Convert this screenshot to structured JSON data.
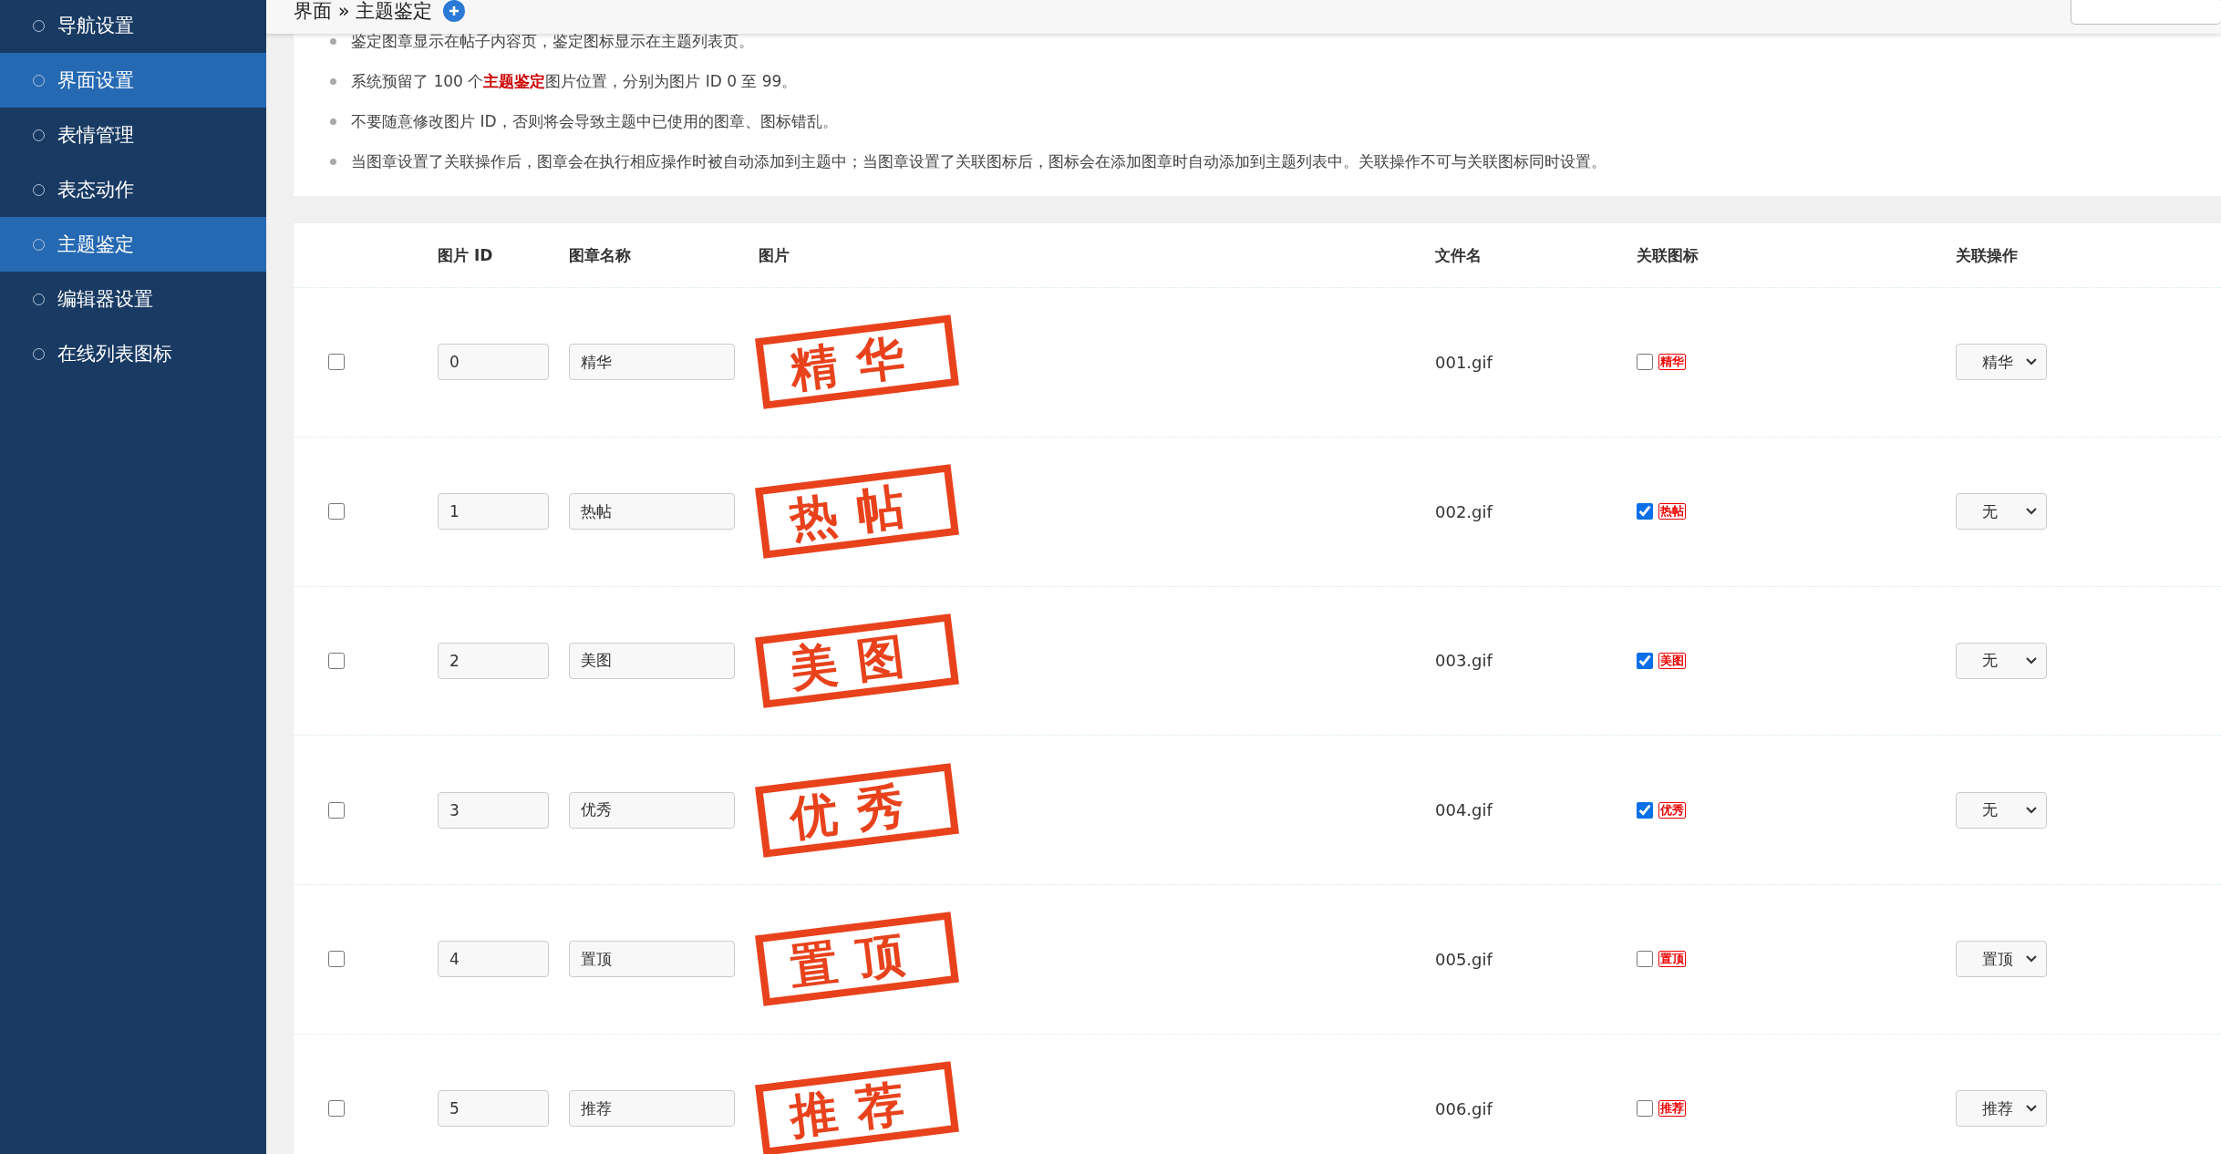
{
  "sidebar": {
    "items": [
      {
        "label": "导航设置",
        "selected": false
      },
      {
        "label": "界面设置",
        "selected": true
      },
      {
        "label": "表情管理",
        "selected": false
      },
      {
        "label": "表态动作",
        "selected": false
      },
      {
        "label": "主题鉴定",
        "selected": true
      },
      {
        "label": "编辑器设置",
        "selected": false
      },
      {
        "label": "在线列表图标",
        "selected": false
      }
    ]
  },
  "header": {
    "breadcrumb": "界面 » 主题鉴定"
  },
  "notes": [
    "鉴定图章显示在帖子内容页，鉴定图标显示在主题列表页。",
    "系统预留了 100 个**主题鉴定**图片位置，分别为图片 ID 0 至 99。",
    "不要随意修改图片 ID，否则将会导致主题中已使用的图章、图标错乱。",
    "当图章设置了关联操作后，图章会在执行相应操作时被自动添加到主题中；当图章设置了关联图标后，图标会在添加图章时自动添加到主题列表中。关联操作不可与关联图标同时设置。"
  ],
  "table": {
    "columns": [
      "图片 ID",
      "图章名称",
      "图片",
      "文件名",
      "关联图标",
      "关联操作"
    ],
    "rows": [
      {
        "selected": false,
        "id": "0",
        "name": "精华",
        "stamp": "精华",
        "file": "001.gif",
        "icon_checked": false,
        "icon_label": "精华",
        "action": "精华"
      },
      {
        "selected": false,
        "id": "1",
        "name": "热帖",
        "stamp": "热帖",
        "file": "002.gif",
        "icon_checked": true,
        "icon_label": "热帖",
        "action": "无"
      },
      {
        "selected": false,
        "id": "2",
        "name": "美图",
        "stamp": "美图",
        "file": "003.gif",
        "icon_checked": true,
        "icon_label": "美图",
        "action": "无"
      },
      {
        "selected": false,
        "id": "3",
        "name": "优秀",
        "stamp": "优秀",
        "file": "004.gif",
        "icon_checked": true,
        "icon_label": "优秀",
        "action": "无"
      },
      {
        "selected": false,
        "id": "4",
        "name": "置顶",
        "stamp": "置顶",
        "file": "005.gif",
        "icon_checked": false,
        "icon_label": "置顶",
        "action": "置顶"
      },
      {
        "selected": false,
        "id": "5",
        "name": "推荐",
        "stamp": "推荐",
        "file": "006.gif",
        "icon_checked": false,
        "icon_label": "推荐",
        "action": "推荐"
      }
    ]
  }
}
